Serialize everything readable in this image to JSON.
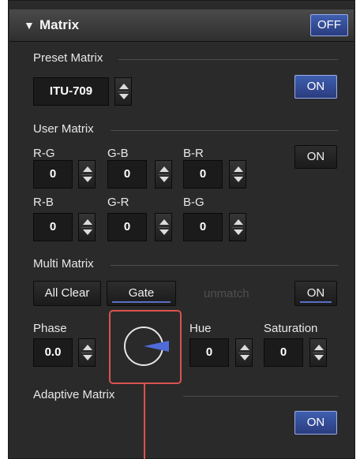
{
  "header": {
    "title": "Matrix",
    "off_label": "OFF"
  },
  "preset_matrix": {
    "label": "Preset Matrix",
    "value": "ITU-709",
    "on_label": "ON"
  },
  "user_matrix": {
    "label": "User Matrix",
    "on_label": "ON",
    "row1": [
      {
        "label": "R-G",
        "value": "0"
      },
      {
        "label": "G-B",
        "value": "0"
      },
      {
        "label": "B-R",
        "value": "0"
      }
    ],
    "row2": [
      {
        "label": "R-B",
        "value": "0"
      },
      {
        "label": "G-R",
        "value": "0"
      },
      {
        "label": "B-G",
        "value": "0"
      }
    ]
  },
  "multi_matrix": {
    "label": "Multi Matrix",
    "all_clear_label": "All Clear",
    "gate_label": "Gate",
    "unmatch_label": "unmatch",
    "on_label": "ON",
    "phase": {
      "label": "Phase",
      "value": "0.0"
    },
    "hue": {
      "label": "Hue",
      "value": "0"
    },
    "saturation": {
      "label": "Saturation",
      "value": "0"
    }
  },
  "adaptive_matrix": {
    "label": "Adaptive Matrix",
    "on_label": "ON"
  },
  "colors": {
    "accent_blue": "#3f5fb0",
    "highlight_red": "#d9534f",
    "panel_bg": "#2a2a2a"
  },
  "icons": {
    "collapse": "triangle-down-icon",
    "phase_dial": "phase-dial-icon"
  }
}
